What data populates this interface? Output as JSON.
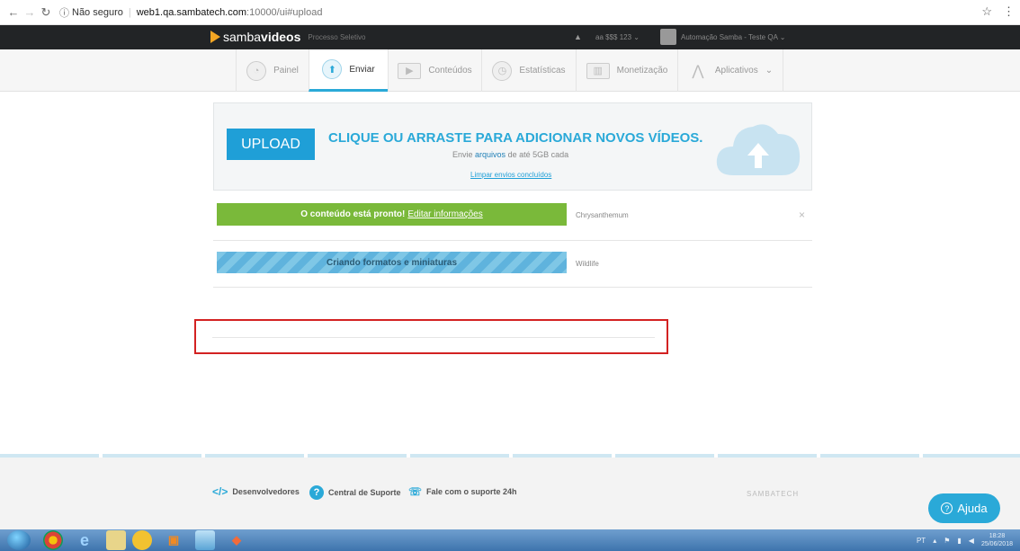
{
  "browser": {
    "security": "Não seguro",
    "url_host": "web1.qa.sambatech.com",
    "url_rest": ":10000/ui#upload"
  },
  "header": {
    "brand_samba": "samba",
    "brand_videos": "videos",
    "subtitle": "Processo Seletivo",
    "account": "aa $$$ 123",
    "user": "Automação Samba - Teste QA"
  },
  "nav": {
    "tabs": [
      {
        "label": "Painel",
        "icon": "dashboard-icon"
      },
      {
        "label": "Enviar",
        "icon": "upload-icon"
      },
      {
        "label": "Conteúdos",
        "icon": "play-icon"
      },
      {
        "label": "Estatísticas",
        "icon": "chart-icon"
      },
      {
        "label": "Monetização",
        "icon": "money-icon"
      },
      {
        "label": "Aplicativos",
        "icon": "apps-icon"
      }
    ],
    "active": "Enviar"
  },
  "upload": {
    "button": "UPLOAD",
    "title": "CLIQUE OU ARRASTE PARA ADICIONAR NOVOS VÍDEOS.",
    "sub_prefix": "Envie",
    "sub_link": "arquivos",
    "sub_suffix": "de até 5GB cada",
    "clear": "Limpar envios concluídos"
  },
  "uploads": [
    {
      "status": "O conteúdo está pronto!",
      "action": "Editar informações",
      "file": "Chrysanthemum"
    },
    {
      "status": "Criando formatos e miniaturas",
      "file": "Wildlife"
    }
  ],
  "footer": {
    "dev": "Desenvolvedores",
    "support": "Central de Suporte",
    "support24": "Fale com o suporte 24h",
    "brand": "SAMBATECH",
    "help": "Ajuda"
  },
  "taskbar": {
    "lang": "PT",
    "time": "18:28",
    "date": "25/06/2018"
  },
  "colors": {
    "accent": "#2aa9d8",
    "success": "#7ab93a",
    "processing": "#6fbde2",
    "highlight_border": "#d32222"
  }
}
